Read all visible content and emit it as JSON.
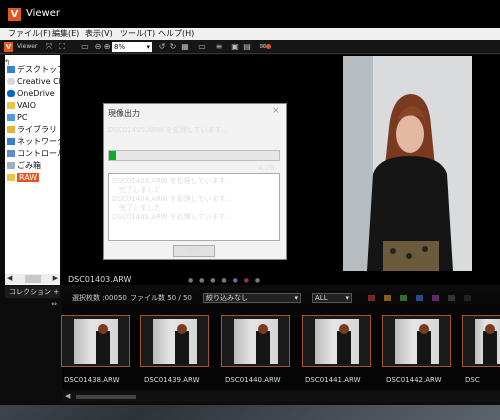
{
  "app": {
    "logo": "V",
    "title": "Viewer"
  },
  "menu": [
    "ファイル(F)",
    "編集(E)",
    "表示(V)",
    "ツール(T)",
    "ヘルプ(H)"
  ],
  "toolbar": {
    "brand": "Viewer",
    "zoom": "8%"
  },
  "sidebar": {
    "items": [
      {
        "label": "デスクトップ",
        "icon": "desktop-icon"
      },
      {
        "label": "Creative Cl",
        "icon": "cloud-icon"
      },
      {
        "label": "OneDrive",
        "icon": "onedrive-icon"
      },
      {
        "label": "VAIO",
        "icon": "folder-icon"
      },
      {
        "label": "PC",
        "icon": "pc-icon"
      },
      {
        "label": "ライブラリ",
        "icon": "library-icon"
      },
      {
        "label": "ネットワーク",
        "icon": "network-icon"
      },
      {
        "label": "コントロール パ",
        "icon": "control-panel-icon"
      },
      {
        "label": "ごみ箱",
        "icon": "recycle-bin-icon"
      },
      {
        "label": "RAW",
        "icon": "folder-icon"
      }
    ],
    "collection_label": "コレクション +"
  },
  "viewer": {
    "filename": "DSC01403.ARW"
  },
  "infobar": {
    "selected": "選択枚数 :00050",
    "files": "ファイル数 50 / 50",
    "filter": "絞り込みなし",
    "all": "ALL"
  },
  "dialog": {
    "title": "現像出力",
    "message": "DSC01405.ARW を処理しています...",
    "progress": 0.04,
    "progress_text": "4.0%",
    "log": [
      "DSC01403.ARW を処理しています...",
      "　完了しました",
      "DSC01404.ARW を処理しています...",
      "　完了しました",
      "DSC01405.ARW を処理しています..."
    ],
    "cancel": "中断"
  },
  "filmstrip": [
    "DSC01438.ARW",
    "DSC01439.ARW",
    "DSC01440.ARW",
    "DSC01441.ARW",
    "DSC01442.ARW",
    "DSC"
  ],
  "colors": {
    "accent": "#e2571f",
    "progress": "#06b025",
    "selected_border": "#a35430"
  }
}
